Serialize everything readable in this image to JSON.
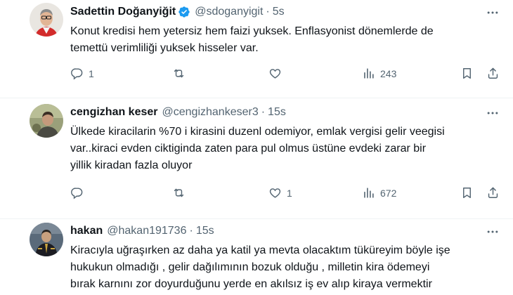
{
  "tweets": [
    {
      "name": "Sadettin Doğanyiğit",
      "verified": true,
      "handle": "@sdoganyigit",
      "sep": "·",
      "time": "5s",
      "lines": [
        "Konut kredisi hem yetersiz hem faizi yuksek. Enflasyonist dönemlerde de",
        "temettü verimliliği yuksek hisseler var."
      ],
      "replies": "1",
      "retweets": "",
      "likes": "",
      "views": "243"
    },
    {
      "name": "cengizhan keser",
      "verified": false,
      "handle": "@cengizhankeser3",
      "sep": "·",
      "time": "15s",
      "lines": [
        "Ülkede kiracilarin %70 i kirasini duzenl odemiyor, emlak vergisi gelir veegisi",
        "var..kiraci evden ciktiginda zaten para pul olmus üstüne evdeki zarar bir",
        "yillik kiradan fazla oluyor"
      ],
      "replies": "",
      "retweets": "",
      "likes": "1",
      "views": "672"
    },
    {
      "name": "hakan",
      "verified": false,
      "handle": "@hakan191736",
      "sep": "·",
      "time": "15s",
      "lines": [
        "Kiracıyla uğraşırken az daha ya katil ya mevta olacaktım tüküreyim böyle işe",
        "hukukun olmadığı , gelir dağılımının bozuk olduğu , milletin kira ödemeyi",
        "bırak karnını zor doyurduğunu yerde en akılsız iş ev alıp kiraya vermektir"
      ]
    }
  ],
  "colors": {
    "text": "#0f1419",
    "muted": "#536471",
    "verified": "#1d9bf0",
    "divider": "#eff3f4"
  }
}
